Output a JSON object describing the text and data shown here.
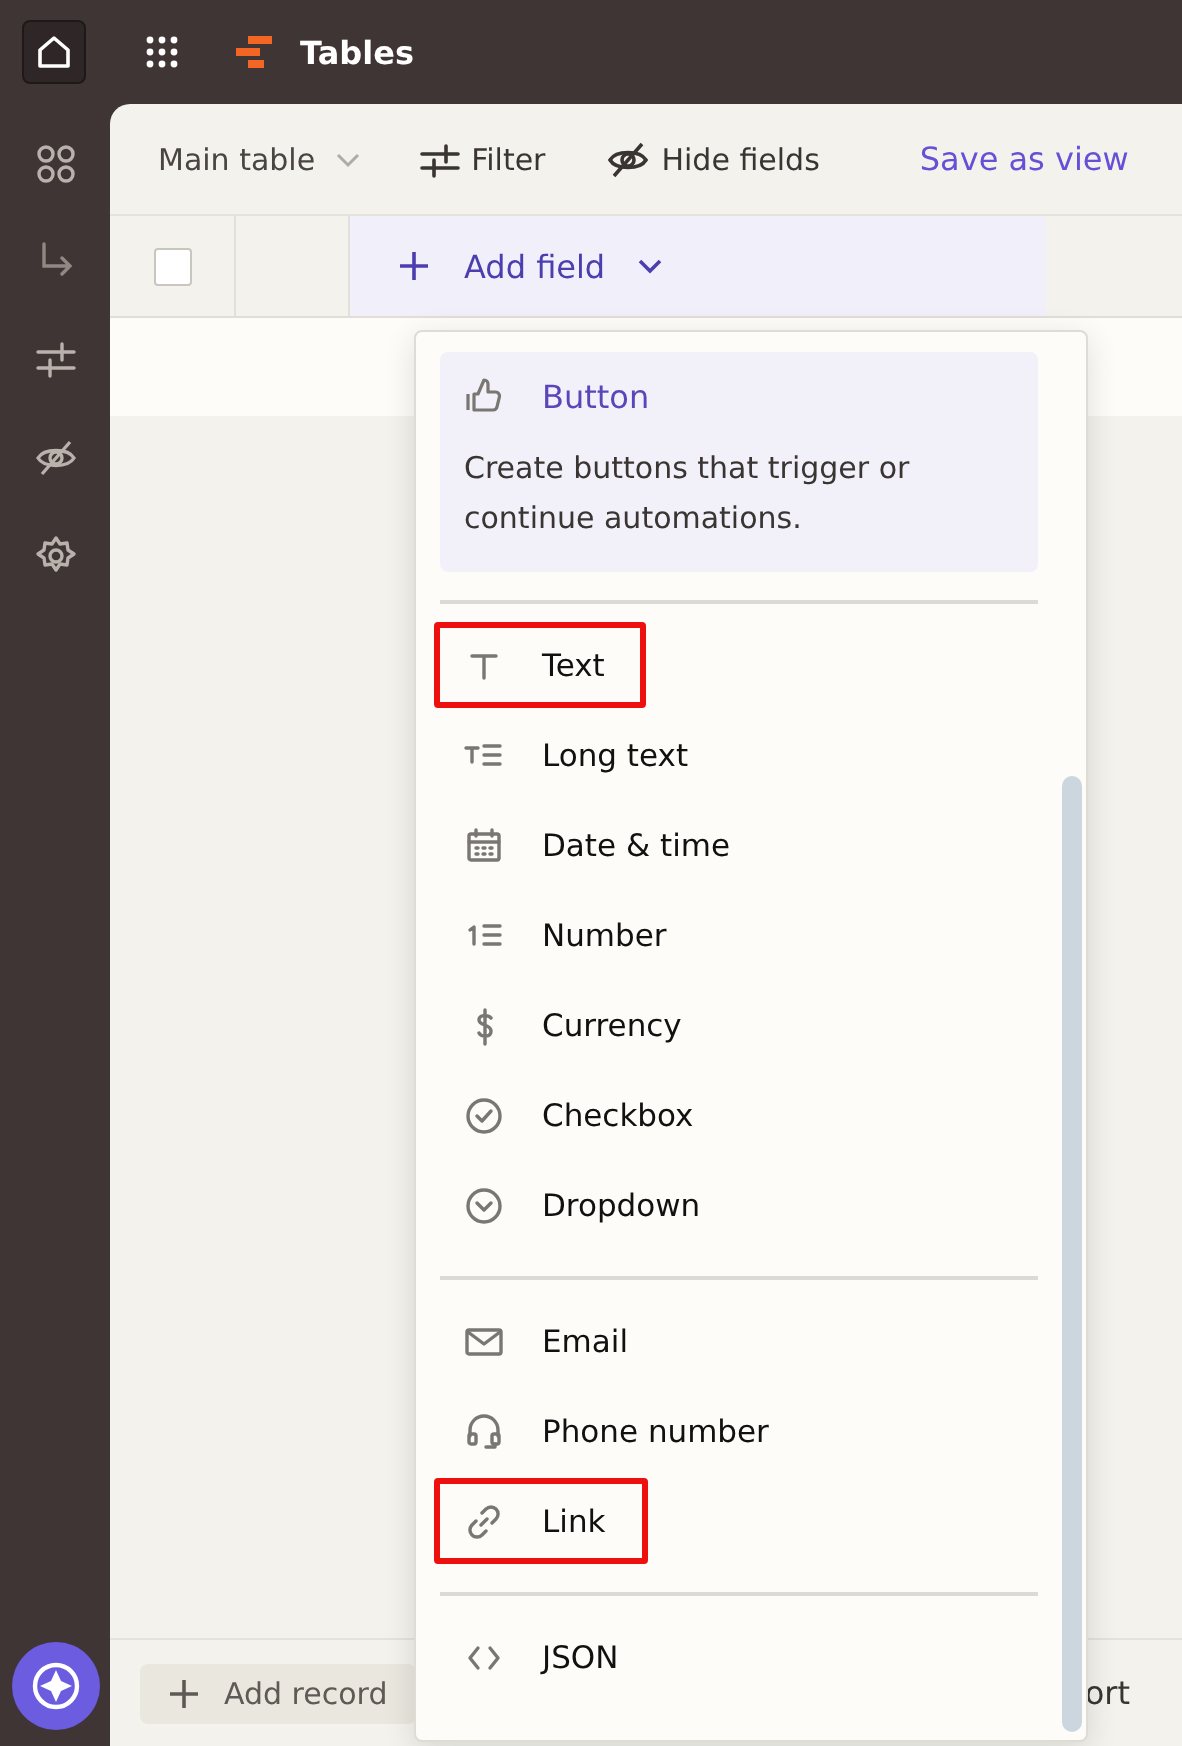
{
  "app": {
    "title": "Tables"
  },
  "sidebar": {
    "items": [
      {
        "kind": "apps"
      },
      {
        "kind": "arrow"
      },
      {
        "kind": "filter"
      },
      {
        "kind": "hide"
      },
      {
        "kind": "settings"
      }
    ]
  },
  "toolbar": {
    "view": "Main table",
    "filter": "Filter",
    "hide_fields": "Hide fields",
    "save": "Save as view"
  },
  "header": {
    "checked": false,
    "add_field": "Add field"
  },
  "footer": {
    "add_record": "Add record",
    "column_2": "ort"
  },
  "menu": {
    "featured": {
      "label": "Button",
      "description": "Create buttons that trigger or continue automations."
    },
    "sections": [
      [
        {
          "kind": "text",
          "label": "Text",
          "highlighted": true
        },
        {
          "kind": "long-text",
          "label": "Long text",
          "highlighted": false
        },
        {
          "kind": "date",
          "label": "Date & time",
          "highlighted": false
        },
        {
          "kind": "number",
          "label": "Number",
          "highlighted": false
        },
        {
          "kind": "currency",
          "label": "Currency",
          "highlighted": false
        },
        {
          "kind": "checkbox",
          "label": "Checkbox",
          "highlighted": false
        },
        {
          "kind": "dropdown",
          "label": "Dropdown",
          "highlighted": false
        }
      ],
      [
        {
          "kind": "email",
          "label": "Email",
          "highlighted": false
        },
        {
          "kind": "phone",
          "label": "Phone number",
          "highlighted": false
        },
        {
          "kind": "link",
          "label": "Link",
          "highlighted": true
        }
      ],
      [
        {
          "kind": "json",
          "label": "JSON",
          "highlighted": false
        }
      ]
    ]
  }
}
